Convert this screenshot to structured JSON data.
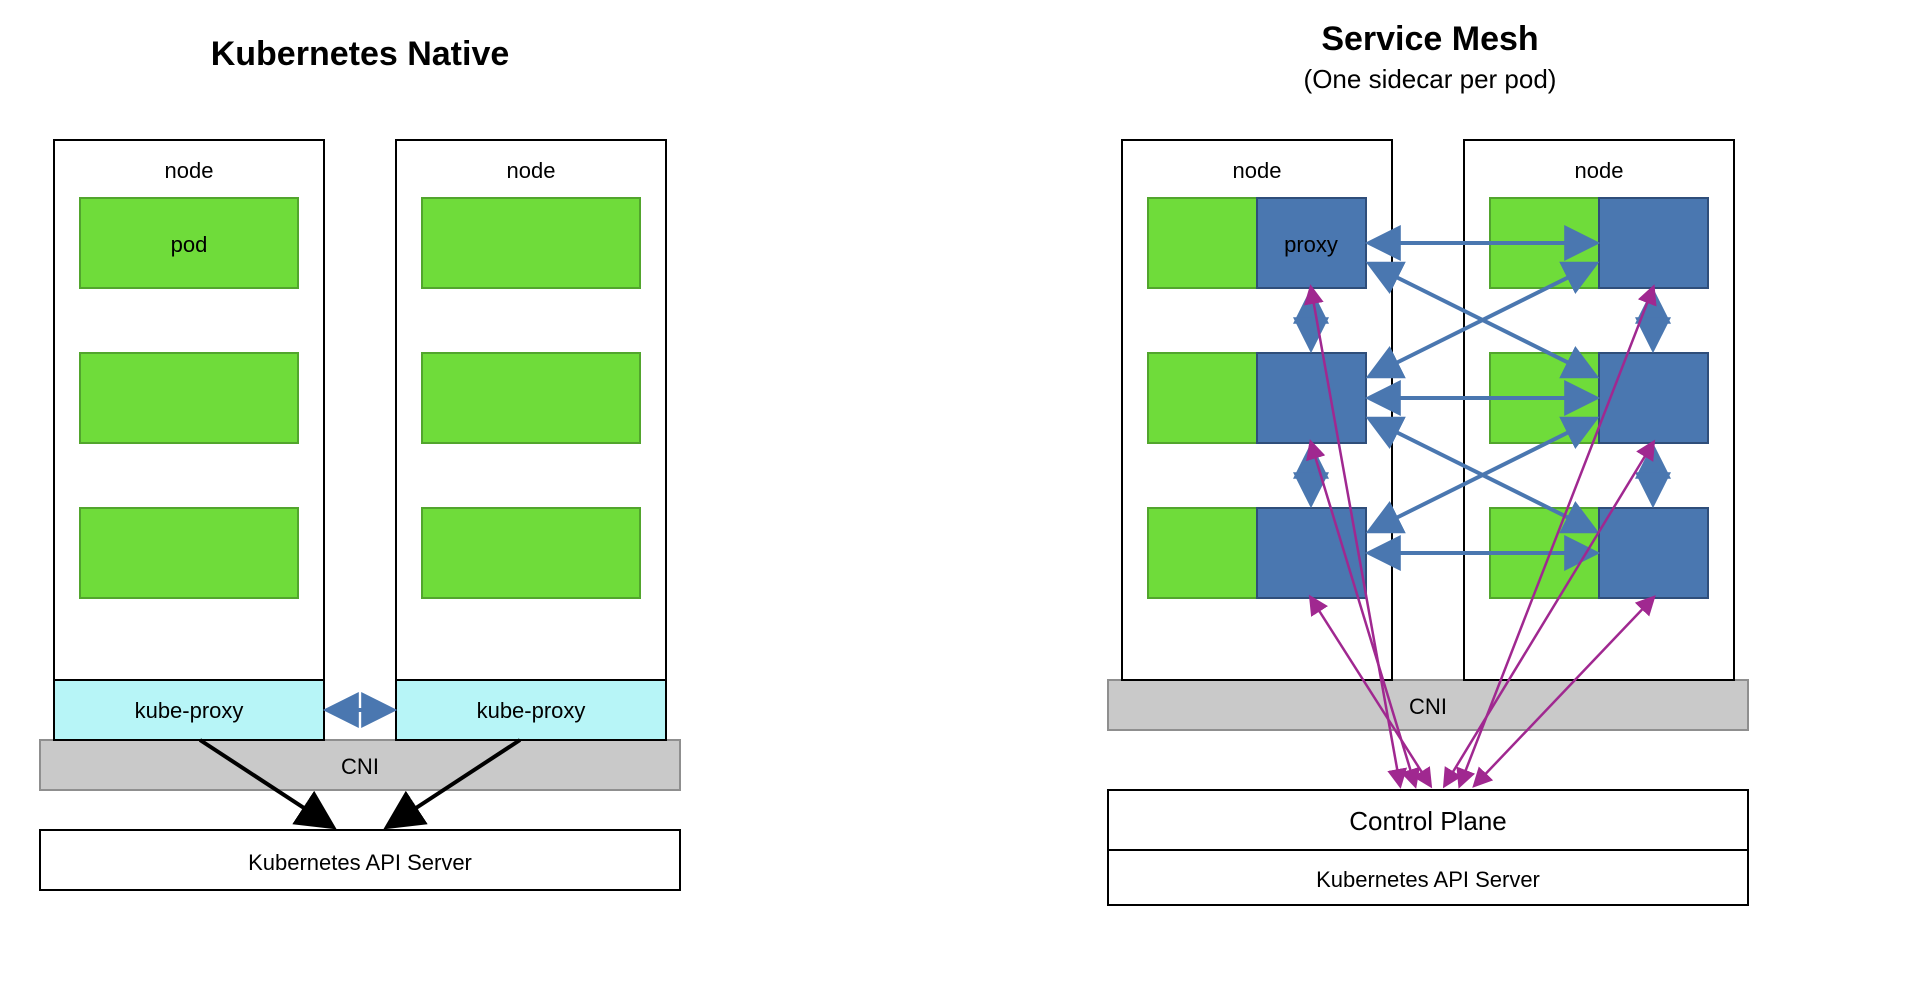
{
  "left": {
    "title": "Kubernetes Native",
    "node_label": "node",
    "pod_label": "pod",
    "kube_proxy_label": "kube-proxy",
    "cni_label": "CNI",
    "api_label": "Kubernetes API Server"
  },
  "right": {
    "title": "Service Mesh",
    "subtitle": "(One sidecar per pod)",
    "node_label": "node",
    "proxy_label": "proxy",
    "cni_label": "CNI",
    "control_plane_label": "Control Plane",
    "api_label": "Kubernetes API Server"
  },
  "colors": {
    "pod_green": "#6fdc3a",
    "pod_green_border": "#52a52d",
    "proxy_blue": "#4a77b0",
    "proxy_blue_border": "#2f4e7a",
    "kube_proxy_fill": "#b7f5f7",
    "cni_fill": "#c9c9c9",
    "arrow_blue": "#4a77b0",
    "arrow_black": "#000000",
    "arrow_purple": "#a02890"
  }
}
